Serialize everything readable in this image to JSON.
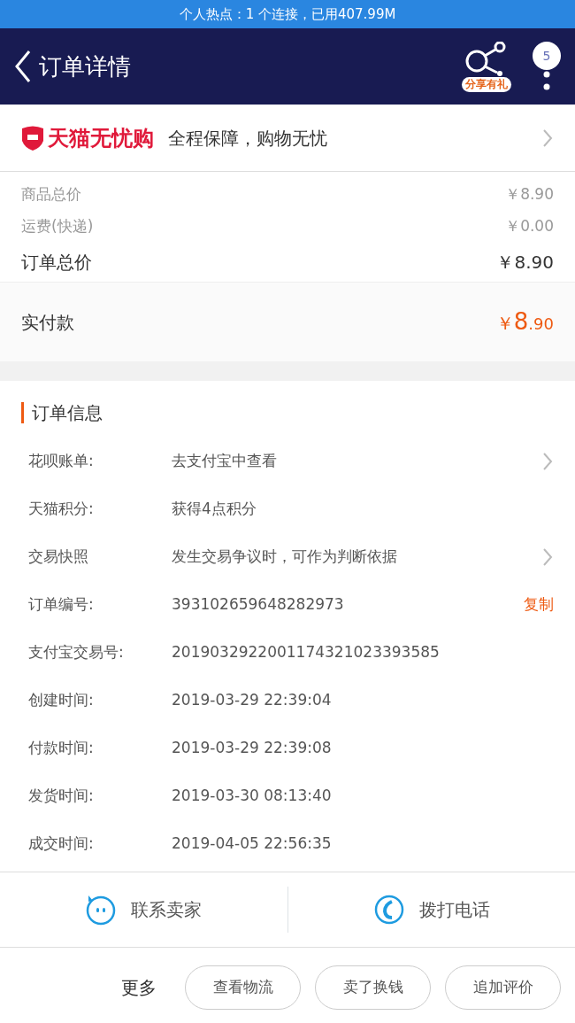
{
  "status_bar": {
    "text": "个人热点：1 个连接，已用407.99M"
  },
  "header": {
    "title": "订单详情",
    "share_label": "分享有礼",
    "badge": "5"
  },
  "banner": {
    "brand": "天猫无忧购",
    "slogan": "全程保障，购物无忧"
  },
  "prices": [
    {
      "kind": "minor",
      "label": "商品总价",
      "value": "￥8.90"
    },
    {
      "kind": "minor",
      "label": "运费(快递)",
      "value": "￥0.00"
    },
    {
      "kind": "total",
      "label": "订单总价",
      "value": "￥8.90"
    }
  ],
  "paid": {
    "label": "实付款",
    "currency": "￥",
    "integer": "8",
    "decimal": ".90"
  },
  "order_info": {
    "title": "订单信息",
    "rows": [
      {
        "label": "花呗账单:",
        "value": "去支付宝中查看",
        "chevron": true
      },
      {
        "label": "天猫积分:",
        "value": "获得4点积分",
        "chevron": false
      },
      {
        "label": "交易快照",
        "value": "发生交易争议时，可作为判断依据",
        "chevron": true
      },
      {
        "label": "订单编号:",
        "value": "393102659648282973",
        "chevron": false,
        "link": "复制"
      },
      {
        "label": "支付宝交易号:",
        "value": "2019032922001174321023393585",
        "chevron": false
      },
      {
        "label": "创建时间:",
        "value": "2019-03-29 22:39:04",
        "chevron": false
      },
      {
        "label": "付款时间:",
        "value": "2019-03-29 22:39:08",
        "chevron": false
      },
      {
        "label": "发货时间:",
        "value": "2019-03-30 08:13:40",
        "chevron": false
      },
      {
        "label": "成交时间:",
        "value": "2019-04-05 22:56:35",
        "chevron": false
      }
    ]
  },
  "contact": [
    {
      "kind": "chat",
      "label": "联系卖家"
    },
    {
      "kind": "phone",
      "label": "拨打电话"
    }
  ],
  "more": {
    "label": "更多",
    "buttons": [
      "查看物流",
      "卖了换钱",
      "追加评价"
    ]
  }
}
